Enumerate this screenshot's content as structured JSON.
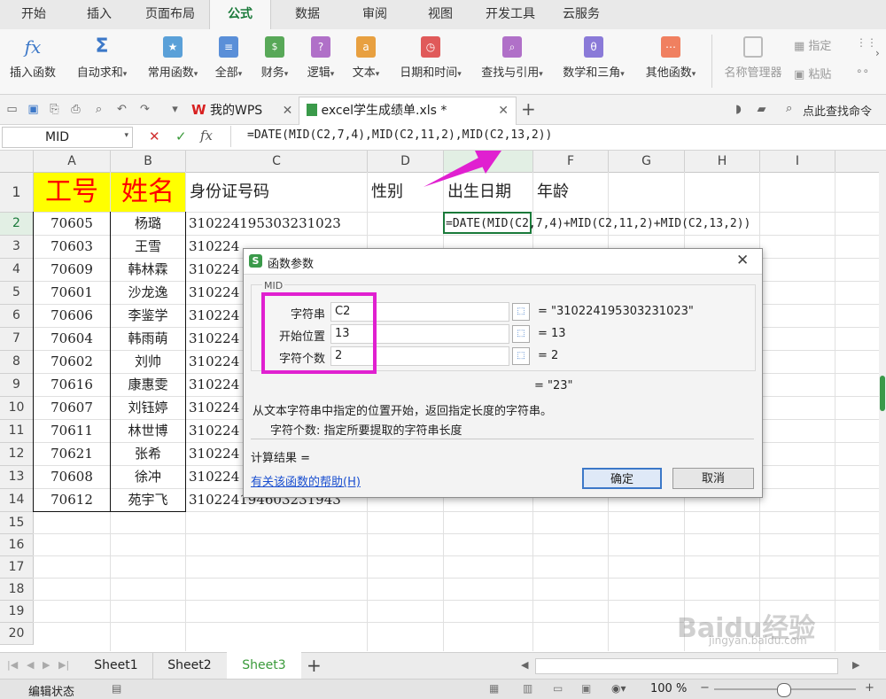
{
  "ribbon_tabs": [
    "开始",
    "插入",
    "页面布局",
    "公式",
    "数据",
    "审阅",
    "视图",
    "开发工具",
    "云服务"
  ],
  "ribbon_buttons": [
    {
      "label": "插入函数",
      "icon": "fx-icon",
      "color": "#3c78c8"
    },
    {
      "label": "自动求和",
      "icon": "sigma-icon",
      "color": "#3c78c8"
    },
    {
      "label": "常用函数",
      "icon": "star-icon",
      "color": "#5aa0d8"
    },
    {
      "label": "全部",
      "icon": "list-icon",
      "color": "#5a8fd8"
    },
    {
      "label": "财务",
      "icon": "finance-icon",
      "color": "#58a858"
    },
    {
      "label": "逻辑",
      "icon": "logic-icon",
      "color": "#b070c8"
    },
    {
      "label": "文本",
      "icon": "text-icon",
      "color": "#e8a040"
    },
    {
      "label": "日期和时间",
      "icon": "clock-icon",
      "color": "#e05a5a"
    },
    {
      "label": "查找与引用",
      "icon": "lookup-icon",
      "color": "#b070c8"
    },
    {
      "label": "数学和三角",
      "icon": "math-icon",
      "color": "#8a7ad8"
    },
    {
      "label": "其他函数",
      "icon": "other-icon",
      "color": "#f08060"
    }
  ],
  "ribbon_right": {
    "name_manager": "名称管理器",
    "assign": "指定",
    "paste": "粘贴"
  },
  "doc_tabs": {
    "wps": "我的WPS",
    "file": "excel学生成绩单.xls *",
    "find": "点此查找命令"
  },
  "formula_bar": {
    "name_box": "MID",
    "fx": "fx",
    "formula": "=DATE(MID(C2,7,4),MID(C2,11,2),MID(C2,13,2))"
  },
  "columns": [
    "A",
    "B",
    "C",
    "D",
    "E",
    "F",
    "G",
    "H",
    "I"
  ],
  "headers": {
    "a": "工号",
    "b": "姓名",
    "c": "身份证号码",
    "d": "性别",
    "e": "出生日期",
    "f": "年龄"
  },
  "active_cell_formula": "=DATE(MID(C2,7,4)+MID(C2,11,2)+MID(C2,13,2))",
  "rows": [
    {
      "id": "70605",
      "name": "杨璐",
      "idnum": "310224195303231023"
    },
    {
      "id": "70603",
      "name": "王雪",
      "idnum": "310224"
    },
    {
      "id": "70609",
      "name": "韩林霖",
      "idnum": "310224"
    },
    {
      "id": "70601",
      "name": "沙龙逸",
      "idnum": "310224"
    },
    {
      "id": "70606",
      "name": "李鉴学",
      "idnum": "310224"
    },
    {
      "id": "70604",
      "name": "韩雨萌",
      "idnum": "310224"
    },
    {
      "id": "70602",
      "name": "刘帅",
      "idnum": "310224"
    },
    {
      "id": "70616",
      "name": "康惠雯",
      "idnum": "310224"
    },
    {
      "id": "70607",
      "name": "刘钰婷",
      "idnum": "310224"
    },
    {
      "id": "70611",
      "name": "林世博",
      "idnum": "310224"
    },
    {
      "id": "70621",
      "name": "张希",
      "idnum": "310224"
    },
    {
      "id": "70608",
      "name": "徐冲",
      "idnum": "310224"
    },
    {
      "id": "70612",
      "name": "苑宇飞",
      "idnum": "310224194603231943"
    }
  ],
  "row_numbers": [
    "1",
    "2",
    "3",
    "4",
    "5",
    "6",
    "7",
    "8",
    "9",
    "10",
    "11",
    "12",
    "13",
    "14",
    "15",
    "16",
    "17",
    "18",
    "19",
    "20"
  ],
  "dialog": {
    "title": "函数参数",
    "func_name": "MID",
    "args": [
      {
        "label": "字符串",
        "value": "C2",
        "result": "= \"310224195303231023\""
      },
      {
        "label": "开始位置",
        "value": "13",
        "result": "= 13"
      },
      {
        "label": "字符个数",
        "value": "2",
        "result": "= 2"
      }
    ],
    "total": "= \"23\"",
    "description": "从文本字符串中指定的位置开始，返回指定长度的字符串。",
    "arg_description": "字符个数:  指定所要提取的字符串长度",
    "calc_result": "计算结果 =",
    "help_link": "有关该函数的帮助(H)",
    "ok": "确定",
    "cancel": "取消"
  },
  "sheet_tabs": [
    "Sheet1",
    "Sheet2",
    "Sheet3"
  ],
  "active_sheet": "Sheet3",
  "status": {
    "mode": "编辑状态",
    "zoom": "100 %"
  },
  "watermark": {
    "brand": "Baidu经验",
    "url": "jingyan.baidu.com"
  },
  "colors": {
    "header_fill": "#ffff00",
    "header_text": "#ff0000",
    "accent_green": "#1a7a3a",
    "highlight": "#e020d0",
    "link": "#1a4fd0"
  }
}
